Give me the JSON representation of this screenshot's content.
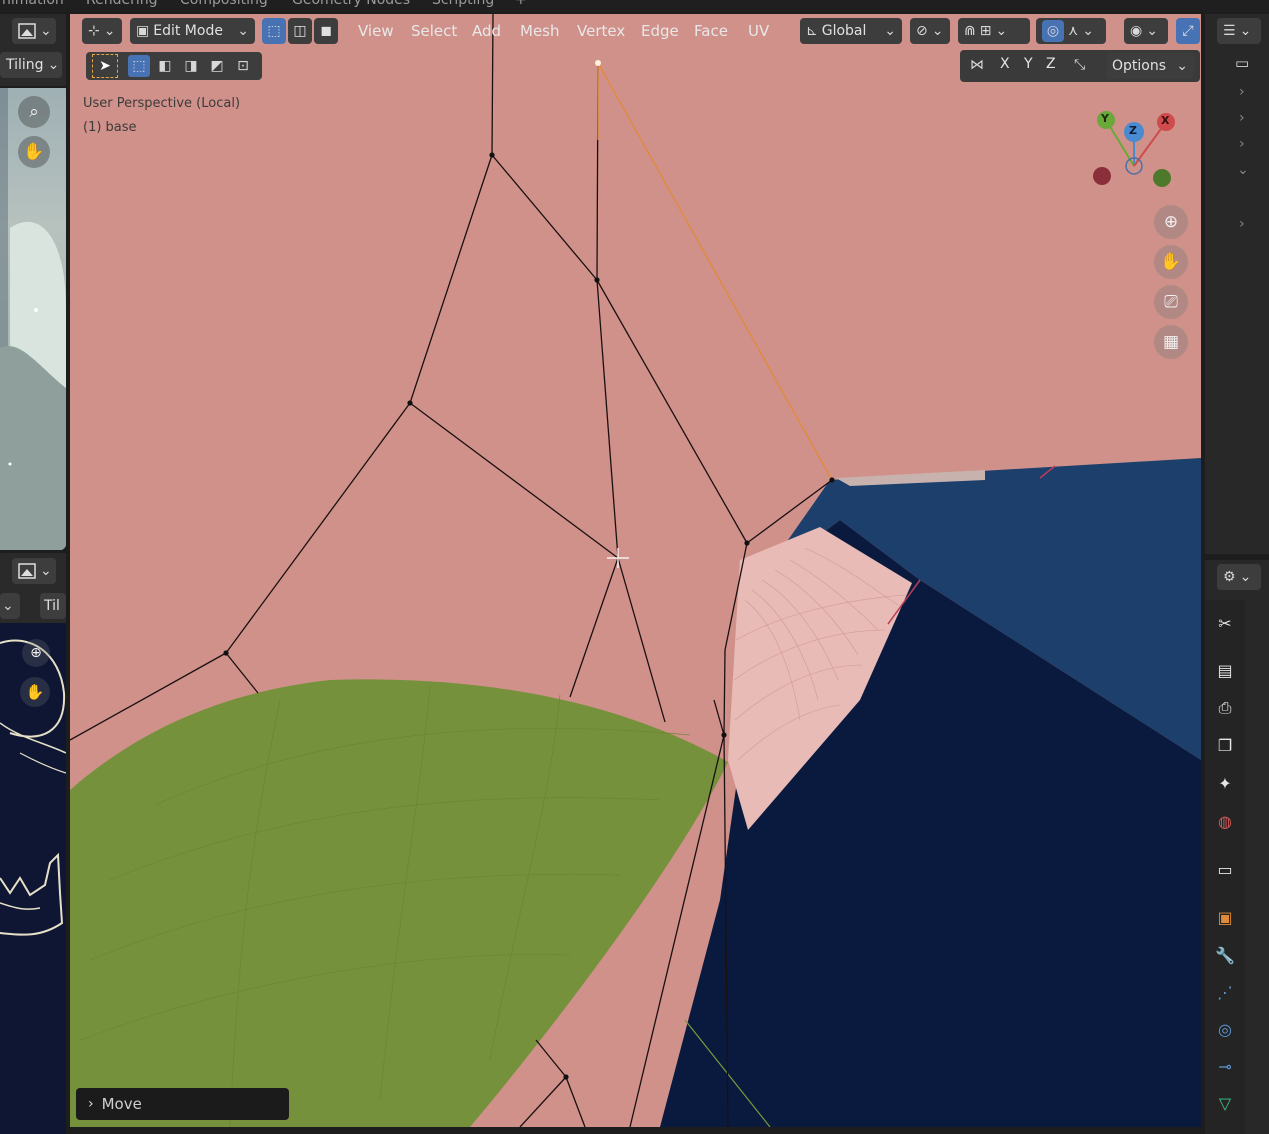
{
  "workspace_tabs": [
    "nimation",
    "Rendering",
    "Compositing",
    "Geometry Nodes",
    "Scripting"
  ],
  "left_editor_top": {
    "tiling_label": "Tiling"
  },
  "left_editor_bottom": {
    "tiling_label": "Til"
  },
  "viewport": {
    "mode_label": "Edit Mode",
    "menus": [
      "View",
      "Select",
      "Add",
      "Mesh",
      "Vertex",
      "Edge",
      "Face",
      "UV"
    ],
    "transform_orientation": "Global",
    "axis_labels": [
      "X",
      "Y",
      "Z"
    ],
    "options_label": "Options",
    "view_label": "User Perspective (Local)",
    "object_label": "(1) base",
    "gizmo": {
      "x": "X",
      "y": "Y",
      "z": "Z"
    },
    "last_operator": "Move"
  },
  "colors": {
    "face_pink": "#d0918a",
    "green_mesh": "#76913b",
    "navy_mesh": "#0a1a3f",
    "blue_mesh": "#1d3f6b",
    "accent_blue": "#4772b3"
  },
  "icons": {
    "editor_type": "viewport-editor-icon",
    "select_tool": "cursor-select-icon",
    "zoom": "zoom-icon",
    "pan": "hand-pan-icon",
    "camera": "camera-view-icon",
    "grid": "ortho-grid-icon"
  }
}
